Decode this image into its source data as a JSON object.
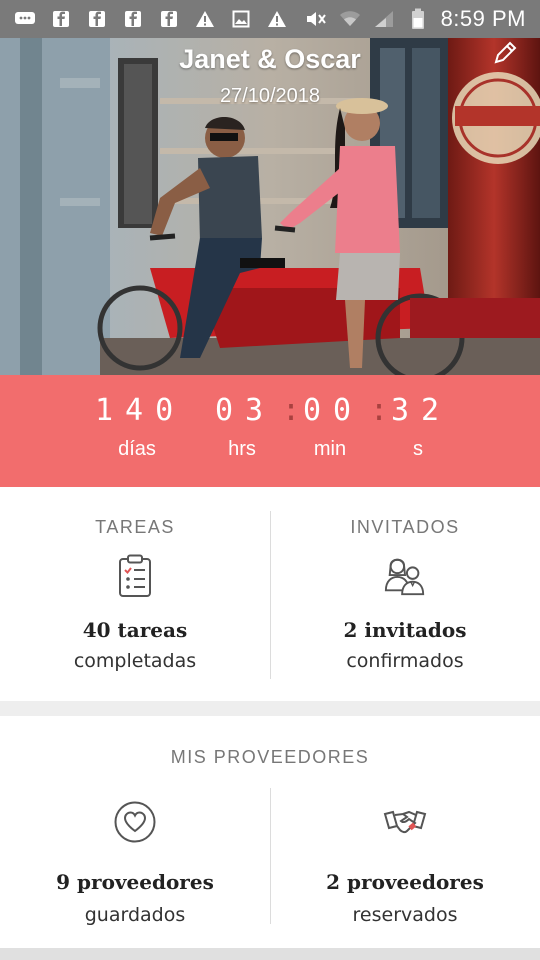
{
  "status_bar": {
    "time": "8:59 PM",
    "icons": [
      "message-icon",
      "facebook-icon",
      "facebook-icon",
      "facebook-icon",
      "facebook-icon",
      "warning-icon",
      "image-icon",
      "warning-icon",
      "mute-icon",
      "wifi-icon",
      "signal-icon",
      "battery-icon"
    ]
  },
  "hero": {
    "couple_name": "Janet & Oscar",
    "wedding_date": "27/10/2018",
    "edit_icon": "pencil-icon"
  },
  "countdown": {
    "days": "140",
    "hours": "03",
    "minutes": "00",
    "seconds": "32",
    "separator": ":",
    "days_label": "días",
    "hours_label": "hrs",
    "minutes_label": "min",
    "seconds_label": "s",
    "background_color": "#f26d6d"
  },
  "tasks": {
    "title": "TAREAS",
    "count_label": "40 tareas",
    "status_label": "completadas",
    "icon": "checklist-icon"
  },
  "guests": {
    "title": "INVITADOS",
    "count_label": "2 invitados",
    "status_label": "confirmados",
    "icon": "guests-icon"
  },
  "vendors": {
    "title": "MIS PROVEEDORES",
    "saved": {
      "count_label": "9 proveedores",
      "status_label": "guardados",
      "icon": "heart-icon"
    },
    "booked": {
      "count_label": "2 proveedores",
      "status_label": "reservados",
      "icon": "handshake-icon"
    }
  }
}
